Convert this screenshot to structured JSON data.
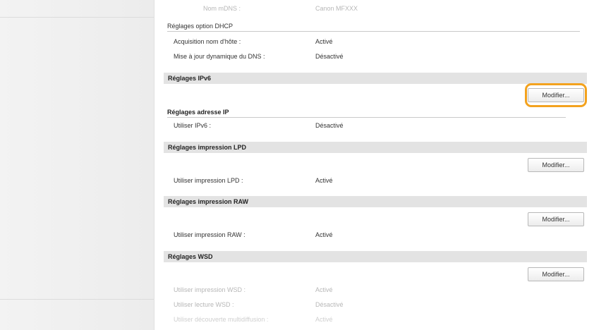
{
  "top": {
    "mdns_name": {
      "label": "Nom mDNS :",
      "value": "Canon MFXXX"
    }
  },
  "dhcp": {
    "header": "Réglages option DHCP",
    "rows": [
      {
        "label": "Acquisition nom d'hôte :",
        "value": "Activé"
      },
      {
        "label": "Mise à jour dynamique du DNS :",
        "value": "Désactivé"
      }
    ]
  },
  "ipv6": {
    "title": "Réglages IPv6",
    "button": "Modifier...",
    "subheader": "Réglages adresse IP",
    "rows": [
      {
        "label": "Utiliser IPv6 :",
        "value": "Désactivé"
      }
    ],
    "highlight_color": "#f3a21e"
  },
  "lpd": {
    "title": "Réglages impression LPD",
    "button": "Modifier...",
    "rows": [
      {
        "label": "Utiliser impression LPD :",
        "value": "Activé"
      }
    ]
  },
  "raw": {
    "title": "Réglages impression RAW",
    "button": "Modifier...",
    "rows": [
      {
        "label": "Utiliser impression RAW :",
        "value": "Activé"
      }
    ]
  },
  "wsd": {
    "title": "Réglages WSD",
    "button": "Modifier...",
    "rows": [
      {
        "label": "Utiliser impression WSD :",
        "value": "Activé"
      },
      {
        "label": "Utiliser lecture WSD :",
        "value": "Désactivé"
      },
      {
        "label": "Utiliser découverte multidiffusion :",
        "value": "Activé"
      }
    ]
  }
}
